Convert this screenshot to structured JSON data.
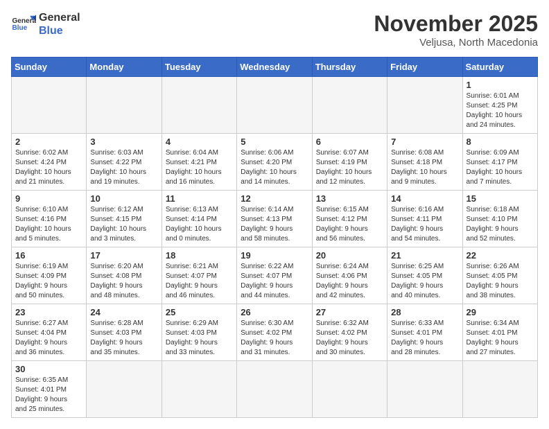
{
  "header": {
    "logo_line1": "General",
    "logo_line2": "Blue",
    "month": "November 2025",
    "location": "Veljusa, North Macedonia"
  },
  "weekdays": [
    "Sunday",
    "Monday",
    "Tuesday",
    "Wednesday",
    "Thursday",
    "Friday",
    "Saturday"
  ],
  "weeks": [
    [
      {
        "day": "",
        "info": ""
      },
      {
        "day": "",
        "info": ""
      },
      {
        "day": "",
        "info": ""
      },
      {
        "day": "",
        "info": ""
      },
      {
        "day": "",
        "info": ""
      },
      {
        "day": "",
        "info": ""
      },
      {
        "day": "1",
        "info": "Sunrise: 6:01 AM\nSunset: 4:25 PM\nDaylight: 10 hours\nand 24 minutes."
      }
    ],
    [
      {
        "day": "2",
        "info": "Sunrise: 6:02 AM\nSunset: 4:24 PM\nDaylight: 10 hours\nand 21 minutes."
      },
      {
        "day": "3",
        "info": "Sunrise: 6:03 AM\nSunset: 4:22 PM\nDaylight: 10 hours\nand 19 minutes."
      },
      {
        "day": "4",
        "info": "Sunrise: 6:04 AM\nSunset: 4:21 PM\nDaylight: 10 hours\nand 16 minutes."
      },
      {
        "day": "5",
        "info": "Sunrise: 6:06 AM\nSunset: 4:20 PM\nDaylight: 10 hours\nand 14 minutes."
      },
      {
        "day": "6",
        "info": "Sunrise: 6:07 AM\nSunset: 4:19 PM\nDaylight: 10 hours\nand 12 minutes."
      },
      {
        "day": "7",
        "info": "Sunrise: 6:08 AM\nSunset: 4:18 PM\nDaylight: 10 hours\nand 9 minutes."
      },
      {
        "day": "8",
        "info": "Sunrise: 6:09 AM\nSunset: 4:17 PM\nDaylight: 10 hours\nand 7 minutes."
      }
    ],
    [
      {
        "day": "9",
        "info": "Sunrise: 6:10 AM\nSunset: 4:16 PM\nDaylight: 10 hours\nand 5 minutes."
      },
      {
        "day": "10",
        "info": "Sunrise: 6:12 AM\nSunset: 4:15 PM\nDaylight: 10 hours\nand 3 minutes."
      },
      {
        "day": "11",
        "info": "Sunrise: 6:13 AM\nSunset: 4:14 PM\nDaylight: 10 hours\nand 0 minutes."
      },
      {
        "day": "12",
        "info": "Sunrise: 6:14 AM\nSunset: 4:13 PM\nDaylight: 9 hours\nand 58 minutes."
      },
      {
        "day": "13",
        "info": "Sunrise: 6:15 AM\nSunset: 4:12 PM\nDaylight: 9 hours\nand 56 minutes."
      },
      {
        "day": "14",
        "info": "Sunrise: 6:16 AM\nSunset: 4:11 PM\nDaylight: 9 hours\nand 54 minutes."
      },
      {
        "day": "15",
        "info": "Sunrise: 6:18 AM\nSunset: 4:10 PM\nDaylight: 9 hours\nand 52 minutes."
      }
    ],
    [
      {
        "day": "16",
        "info": "Sunrise: 6:19 AM\nSunset: 4:09 PM\nDaylight: 9 hours\nand 50 minutes."
      },
      {
        "day": "17",
        "info": "Sunrise: 6:20 AM\nSunset: 4:08 PM\nDaylight: 9 hours\nand 48 minutes."
      },
      {
        "day": "18",
        "info": "Sunrise: 6:21 AM\nSunset: 4:07 PM\nDaylight: 9 hours\nand 46 minutes."
      },
      {
        "day": "19",
        "info": "Sunrise: 6:22 AM\nSunset: 4:07 PM\nDaylight: 9 hours\nand 44 minutes."
      },
      {
        "day": "20",
        "info": "Sunrise: 6:24 AM\nSunset: 4:06 PM\nDaylight: 9 hours\nand 42 minutes."
      },
      {
        "day": "21",
        "info": "Sunrise: 6:25 AM\nSunset: 4:05 PM\nDaylight: 9 hours\nand 40 minutes."
      },
      {
        "day": "22",
        "info": "Sunrise: 6:26 AM\nSunset: 4:05 PM\nDaylight: 9 hours\nand 38 minutes."
      }
    ],
    [
      {
        "day": "23",
        "info": "Sunrise: 6:27 AM\nSunset: 4:04 PM\nDaylight: 9 hours\nand 36 minutes."
      },
      {
        "day": "24",
        "info": "Sunrise: 6:28 AM\nSunset: 4:03 PM\nDaylight: 9 hours\nand 35 minutes."
      },
      {
        "day": "25",
        "info": "Sunrise: 6:29 AM\nSunset: 4:03 PM\nDaylight: 9 hours\nand 33 minutes."
      },
      {
        "day": "26",
        "info": "Sunrise: 6:30 AM\nSunset: 4:02 PM\nDaylight: 9 hours\nand 31 minutes."
      },
      {
        "day": "27",
        "info": "Sunrise: 6:32 AM\nSunset: 4:02 PM\nDaylight: 9 hours\nand 30 minutes."
      },
      {
        "day": "28",
        "info": "Sunrise: 6:33 AM\nSunset: 4:01 PM\nDaylight: 9 hours\nand 28 minutes."
      },
      {
        "day": "29",
        "info": "Sunrise: 6:34 AM\nSunset: 4:01 PM\nDaylight: 9 hours\nand 27 minutes."
      }
    ],
    [
      {
        "day": "30",
        "info": "Sunrise: 6:35 AM\nSunset: 4:01 PM\nDaylight: 9 hours\nand 25 minutes."
      },
      {
        "day": "",
        "info": ""
      },
      {
        "day": "",
        "info": ""
      },
      {
        "day": "",
        "info": ""
      },
      {
        "day": "",
        "info": ""
      },
      {
        "day": "",
        "info": ""
      },
      {
        "day": "",
        "info": ""
      }
    ]
  ]
}
